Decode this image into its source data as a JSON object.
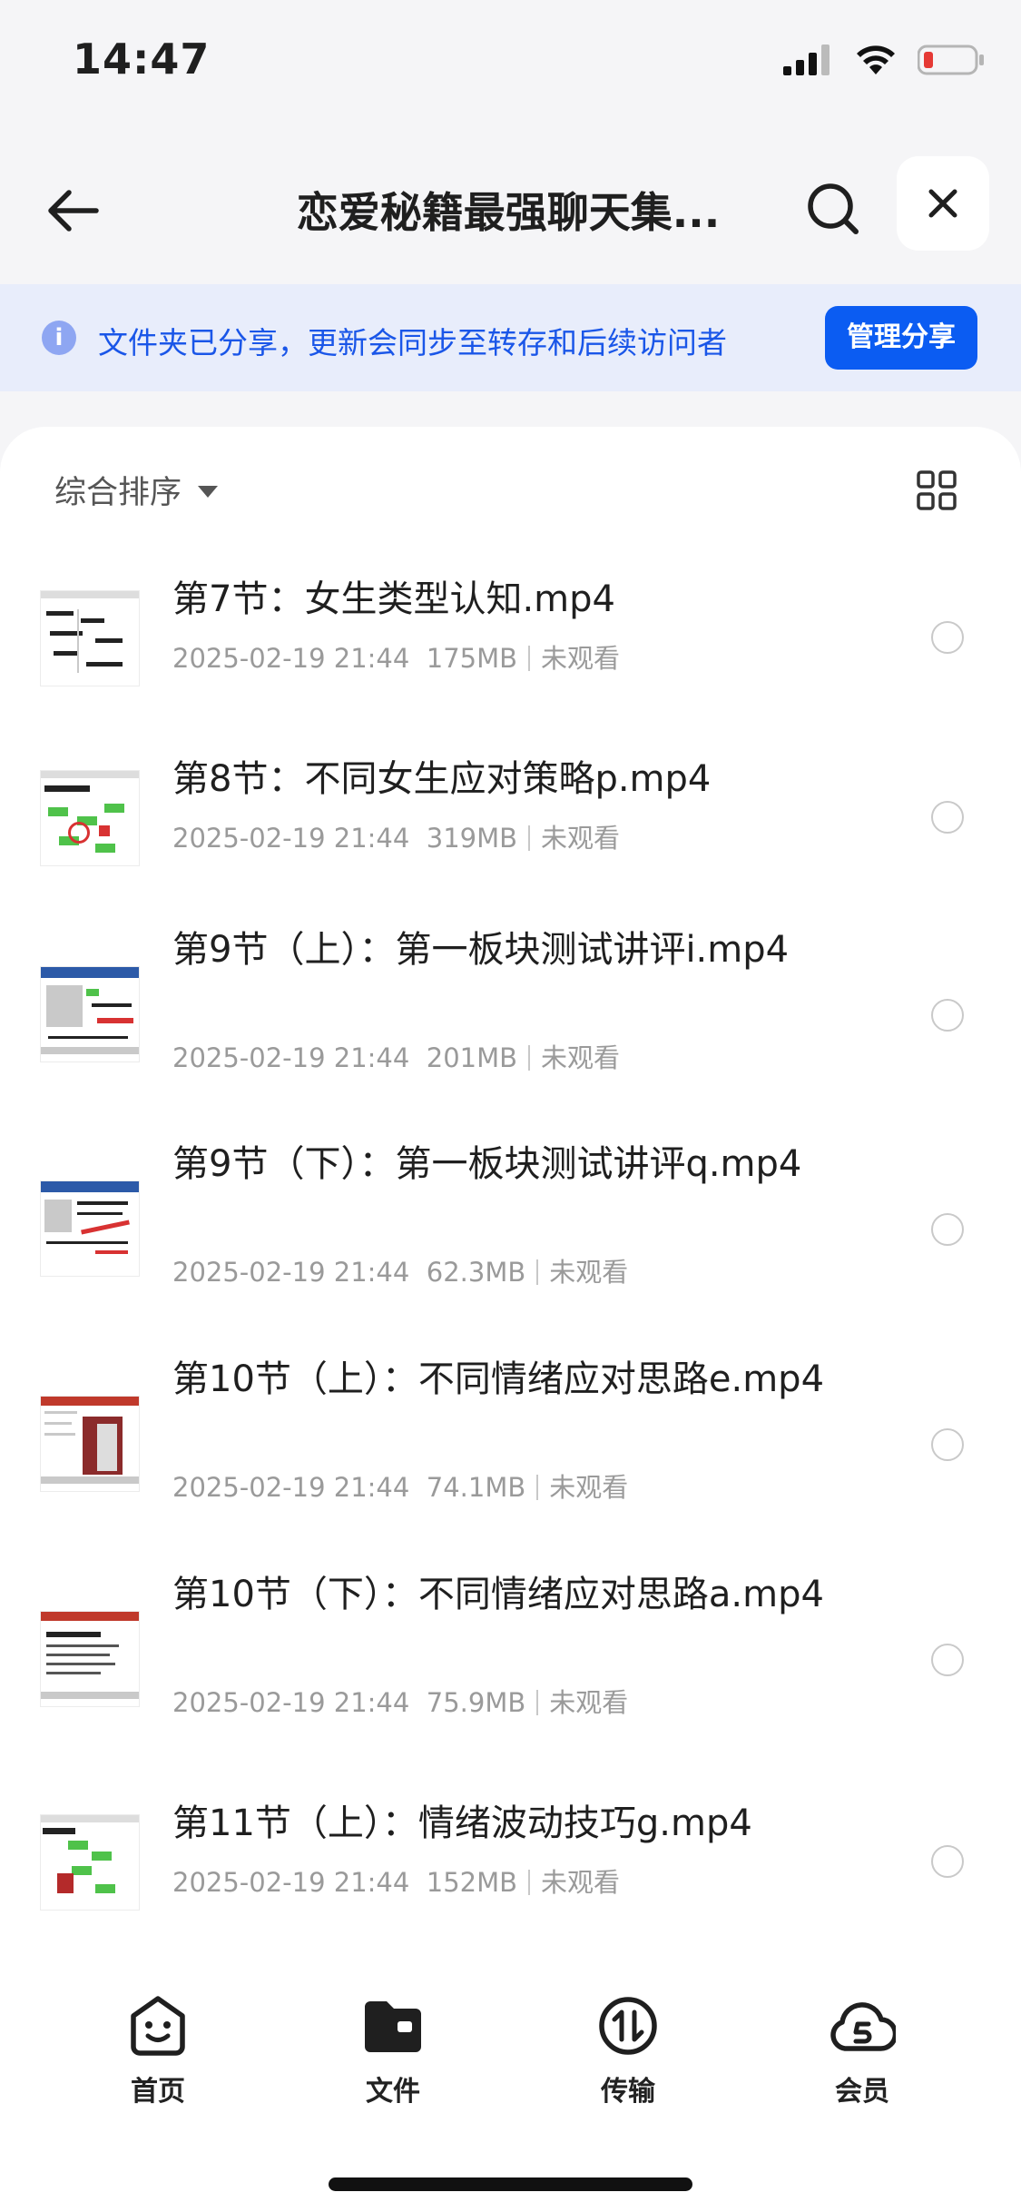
{
  "status_bar": {
    "time": "14:47",
    "battery_color": "#e53935"
  },
  "nav": {
    "title": "恋爱秘籍最强聊天集..."
  },
  "share_banner": {
    "info_icon": "i",
    "text": "文件夹已分享，更新会同步至转存和后续访问者",
    "button": "管理分享",
    "accent": "#0b5cf2"
  },
  "sort": {
    "label": "综合排序"
  },
  "files": [
    {
      "name": "第7节：女生类型认知.mp4",
      "date": "2025-02-19 21:44",
      "size": "175MB",
      "status": "未观看"
    },
    {
      "name": "第8节：不同女生应对策略p.mp4",
      "date": "2025-02-19 21:44",
      "size": "319MB",
      "status": "未观看"
    },
    {
      "name": "第9节（上）：第一板块测试讲评i.mp4",
      "date": "2025-02-19 21:44",
      "size": "201MB",
      "status": "未观看"
    },
    {
      "name": "第9节（下）：第一板块测试讲评q.mp4",
      "date": "2025-02-19 21:44",
      "size": "62.3MB",
      "status": "未观看"
    },
    {
      "name": "第10节（上）：不同情绪应对思路e.mp4",
      "date": "2025-02-19 21:44",
      "size": "74.1MB",
      "status": "未观看"
    },
    {
      "name": "第10节（下）：不同情绪应对思路a.mp4",
      "date": "2025-02-19 21:44",
      "size": "75.9MB",
      "status": "未观看"
    },
    {
      "name": "第11节（上）：情绪波动技巧g.mp4",
      "date": "2025-02-19 21:44",
      "size": "152MB",
      "status": "未观看"
    }
  ],
  "tabs": [
    {
      "label": "首页",
      "icon": "smile-face-icon"
    },
    {
      "label": "文件",
      "icon": "folder-icon"
    },
    {
      "label": "传输",
      "icon": "transfer-icon"
    },
    {
      "label": "会员",
      "icon": "cloud-vip-icon"
    }
  ]
}
